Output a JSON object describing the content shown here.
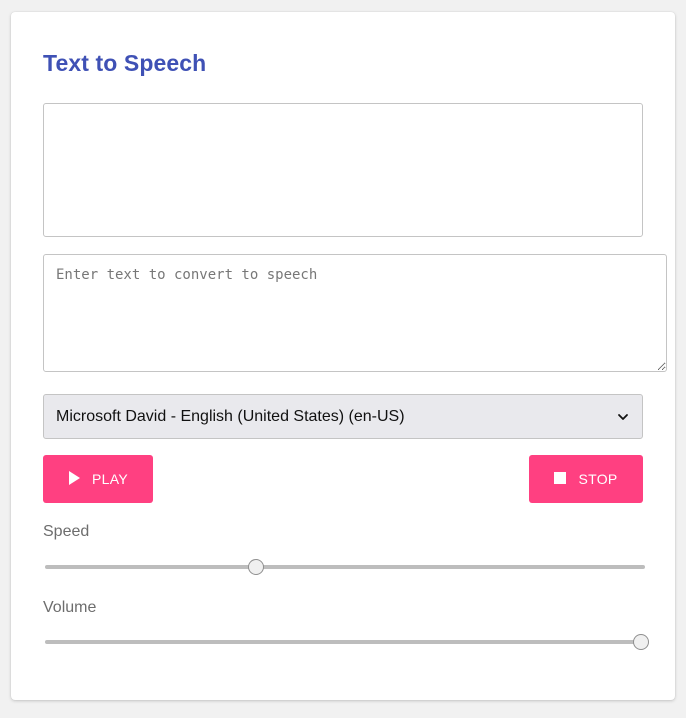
{
  "app": {
    "title": "Text to Speech"
  },
  "output": {
    "text": ""
  },
  "input": {
    "value": "",
    "placeholder": "Enter text to convert to speech"
  },
  "voice_select": {
    "selected": "Microsoft David - English (United States) (en-US)",
    "icon": "chevron-down-icon"
  },
  "buttons": {
    "play": {
      "label": "PLAY",
      "icon": "play-icon"
    },
    "stop": {
      "label": "STOP",
      "icon": "stop-icon"
    }
  },
  "controls": {
    "speed": {
      "label": "Speed",
      "value_fraction": 0.34
    },
    "volume": {
      "label": "Volume",
      "value_fraction": 1.0
    }
  },
  "colors": {
    "title": "#3f51b5",
    "accent": "#ff4081",
    "select_bg": "#e9e9ed"
  }
}
